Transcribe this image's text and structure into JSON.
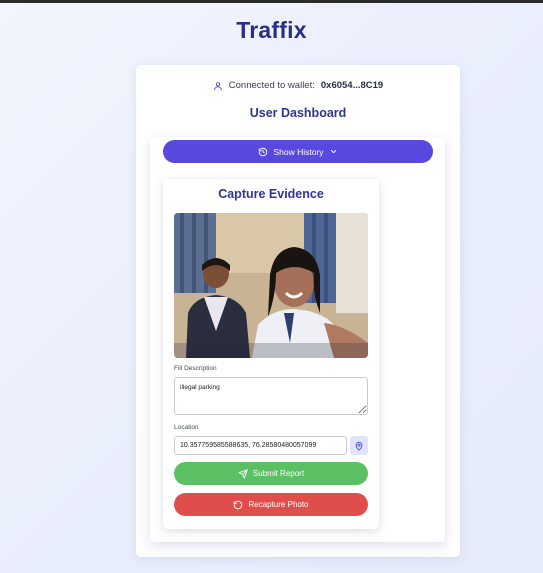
{
  "app": {
    "title": "Traffix"
  },
  "wallet": {
    "prefix": "Connected to wallet:",
    "address": "0x6054...8C19",
    "icon": "user-icon"
  },
  "dashboard": {
    "title": "User Dashboard"
  },
  "history": {
    "label": "Show History",
    "icon": "history-icon",
    "chevron": "chevron-down-icon"
  },
  "capture": {
    "title": "Capture Evidence",
    "photo_alt": "captured evidence photo",
    "description_label": "Fill Description",
    "description_value": "illegal parking",
    "location_label": "Location",
    "location_value": "10.357759585588635, 76.28580480057099",
    "location_icon": "map-pin-icon",
    "submit_label": "Submit Report",
    "submit_icon": "send-icon",
    "recapture_label": "Recapture Photo",
    "recapture_icon": "rotate-icon"
  },
  "colors": {
    "brand": "#2a2f86",
    "primary_button": "#5848df",
    "submit": "#5bbf63",
    "recapture": "#e04e4c"
  }
}
